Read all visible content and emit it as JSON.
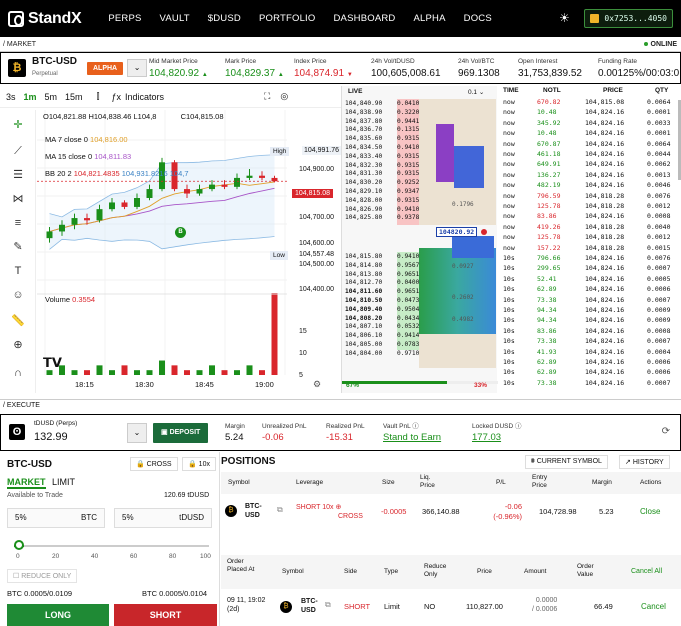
{
  "nav": {
    "brand": "StandX",
    "menu": [
      "PERPS",
      "VAULT",
      "$DUSD",
      "PORTFOLIO",
      "DASHBOARD",
      "ALPHA",
      "DOCS"
    ],
    "wallet": "0x7253...4050"
  },
  "section_market": "/ MARKET",
  "status_online": "ONLINE",
  "ticker": {
    "symbol": "BTC-USD",
    "type": "Perpetual",
    "badge": "ALPHA",
    "mid_label": "Mid Market Price",
    "mid_value": "104,820.92",
    "mark_label": "Mark Price",
    "mark_value": "104,829.37",
    "index_label": "Index Price",
    "index_value": "104,874.91",
    "vol24_label": "24h Vol/tDUSD",
    "vol24_value": "100,605,008.61",
    "volbtc_label": "24h Vol/BTC",
    "volbtc_value": "969.1308",
    "oi_label": "Open Interest",
    "oi_value": "31,753,839.52",
    "fr_label": "Funding Rate",
    "fr_value": "0.00125%/00:03:0"
  },
  "chart_toolbar": {
    "intervals": [
      "3s",
      "1m",
      "5m",
      "15m"
    ],
    "active_interval": "1m",
    "indicators_label": "Indicators"
  },
  "chart": {
    "ohlc_o": "O104,821.88",
    "ohlc_h": "H104,838.46",
    "ohlc_l": "L104,8",
    "ohlc_c": "C104,815.08",
    "ma7_label": "MA 7 close 0",
    "ma7_value": "104,816.00",
    "ma15_label": "MA 15 close 0",
    "ma15_value": "104,811.83",
    "bb_label": "BB 20 2",
    "bb_v1": "104,821.4835",
    "bb_v2": "104,931.8216",
    "bb_v3": "104,7",
    "volume_label": "Volume",
    "volume_value": "0.3554",
    "price_ticks": [
      "104,900.00",
      "104,800.00",
      "104,700.00",
      "104,600.00",
      "104,500.00",
      "104,400.00"
    ],
    "high_label": "High",
    "high_value": "104,991.76",
    "low_label": "Low",
    "low_value": "104,557.48",
    "last_price": "104,815.08",
    "vol_ticks": [
      "15",
      "10",
      "5"
    ],
    "time_ticks": [
      "18:15",
      "18:30",
      "18:45",
      "19:00"
    ],
    "marker": "B"
  },
  "chart_data": {
    "type": "candlestick",
    "x": [
      "18:03",
      "18:06",
      "18:09",
      "18:12",
      "18:15",
      "18:18",
      "18:21",
      "18:24",
      "18:27",
      "18:30",
      "18:33",
      "18:36",
      "18:39",
      "18:42",
      "18:45",
      "18:48",
      "18:51",
      "18:54",
      "18:57"
    ],
    "open": [
      104560,
      104590,
      104620,
      104650,
      104640,
      104690,
      104720,
      104700,
      104740,
      104780,
      104900,
      104780,
      104760,
      104780,
      104800,
      104790,
      104830,
      104840,
      104830
    ],
    "close": [
      104590,
      104620,
      104650,
      104640,
      104690,
      104720,
      104700,
      104740,
      104780,
      104900,
      104780,
      104760,
      104780,
      104800,
      104790,
      104830,
      104840,
      104830,
      104815
    ],
    "high": [
      104610,
      104640,
      104670,
      104670,
      104710,
      104740,
      104730,
      104760,
      104800,
      104920,
      104910,
      104800,
      104800,
      104820,
      104820,
      104850,
      104870,
      104860,
      104840
    ],
    "low": [
      104540,
      104570,
      104600,
      104620,
      104630,
      104680,
      104690,
      104690,
      104730,
      104770,
      104770,
      104740,
      104750,
      104770,
      104780,
      104780,
      104820,
      104820,
      104810
    ],
    "volume": [
      1,
      2,
      1,
      1,
      2,
      1,
      2,
      1,
      1,
      3,
      2,
      1,
      1,
      2,
      1,
      1,
      2,
      1,
      17
    ],
    "ylim": [
      104350,
      105000
    ],
    "legend": [
      "MA 7 close 0",
      "MA 15 close 0",
      "BB 20 2",
      "Volume"
    ]
  },
  "orderbook": {
    "live_label": "LIVE",
    "step": "0.1",
    "asks": [
      [
        "104,840.90",
        "0.0410"
      ],
      [
        "104,838.90",
        "0.3220"
      ],
      [
        "104,837.80",
        "0.9441"
      ],
      [
        "104,836.70",
        "0.1315"
      ],
      [
        "104,835.60",
        "0.9315"
      ],
      [
        "104,834.50",
        "0.9410"
      ],
      [
        "104,833.40",
        "0.9315"
      ],
      [
        "104,832.30",
        "0.9315"
      ],
      [
        "104,831.30",
        "0.9315"
      ],
      [
        "104,830.20",
        "0.9252"
      ],
      [
        "104,829.10",
        "0.9347"
      ],
      [
        "104,828.00",
        "0.9315"
      ],
      [
        "104,826.90",
        "0.9410"
      ],
      [
        "104,825.80",
        "0.9378"
      ]
    ],
    "bids": [
      [
        "104,815.80",
        "0.9410"
      ],
      [
        "104,814.80",
        "0.9567"
      ],
      [
        "104,813.80",
        "0.9651"
      ],
      [
        "104,812.70",
        "0.0400"
      ],
      [
        "104,811.60",
        "0.9651"
      ],
      [
        "104,810.50",
        "0.0473"
      ],
      [
        "104,809.40",
        "0.9504"
      ],
      [
        "104,808.20",
        "0.0434"
      ],
      [
        "104,807.10",
        "0.0532"
      ],
      [
        "104,806.10",
        "0.9414"
      ],
      [
        "104,805.00",
        "0.0783"
      ],
      [
        "104,804.00",
        "0.9710"
      ]
    ],
    "mid_price": "104820.92",
    "annotations": [
      "0.1796",
      "0.0927",
      "0.2602",
      "0.4982"
    ],
    "bid_pct": "67%",
    "ask_pct": "33%"
  },
  "trades": {
    "headers": [
      "TIME",
      "NOTL",
      "PRICE",
      "QTY"
    ],
    "rows": [
      [
        "now",
        "670.82",
        "104,815.08",
        "0.0064"
      ],
      [
        "now",
        "10.48",
        "104,824.16",
        "0.0001"
      ],
      [
        "now",
        "345.92",
        "104,824.16",
        "0.0033"
      ],
      [
        "now",
        "10.48",
        "104,824.16",
        "0.0001"
      ],
      [
        "now",
        "670.87",
        "104,824.16",
        "0.0064"
      ],
      [
        "now",
        "461.18",
        "104,824.16",
        "0.0044"
      ],
      [
        "now",
        "649.91",
        "104,824.16",
        "0.0062"
      ],
      [
        "now",
        "136.27",
        "104,824.16",
        "0.0013"
      ],
      [
        "now",
        "482.19",
        "104,824.16",
        "0.0046"
      ],
      [
        "now",
        "796.59",
        "104,818.28",
        "0.0076"
      ],
      [
        "now",
        "125.78",
        "104,818.28",
        "0.0012"
      ],
      [
        "now",
        "83.86",
        "104,824.16",
        "0.0008"
      ],
      [
        "now",
        "419.26",
        "104,818.28",
        "0.0040"
      ],
      [
        "now",
        "125.78",
        "104,818.28",
        "0.0012"
      ],
      [
        "now",
        "157.22",
        "104,818.28",
        "0.0015"
      ],
      [
        "10s",
        "796.66",
        "104,824.16",
        "0.0076"
      ],
      [
        "10s",
        "299.65",
        "104,824.16",
        "0.0007"
      ],
      [
        "10s",
        "52.41",
        "104,824.16",
        "0.0005"
      ],
      [
        "10s",
        "62.89",
        "104,824.16",
        "0.0006"
      ],
      [
        "10s",
        "73.38",
        "104,824.16",
        "0.0007"
      ],
      [
        "10s",
        "94.34",
        "104,824.16",
        "0.0009"
      ],
      [
        "10s",
        "94.34",
        "104,824.16",
        "0.0009"
      ],
      [
        "10s",
        "83.86",
        "104,824.16",
        "0.0008"
      ],
      [
        "10s",
        "73.38",
        "104,824.16",
        "0.0007"
      ],
      [
        "10s",
        "41.93",
        "104,824.16",
        "0.0004"
      ],
      [
        "10s",
        "62.89",
        "104,824.16",
        "0.0006"
      ],
      [
        "10s",
        "62.89",
        "104,824.16",
        "0.0006"
      ],
      [
        "10s",
        "73.38",
        "104,824.16",
        "0.0007"
      ]
    ]
  },
  "section_execute": "/ EXECUTE",
  "account": {
    "asset_label": "tDUSD (Perps)",
    "asset_value": "132.99",
    "deposit": "DEPOSIT",
    "margin_label": "Margin",
    "margin_value": "5.24",
    "upnl_label": "Unrealized PnL",
    "upnl_value": "-0.06",
    "rpnl_label": "Realized PnL",
    "rpnl_value": "-15.31",
    "vault_label": "Vault PnL",
    "vault_value": "Stand to Earn",
    "locked_label": "Locked DUSD",
    "locked_value": "177.03"
  },
  "order_form": {
    "symbol": "BTC-USD",
    "margin_mode": "CROSS",
    "leverage": "10x",
    "tab_market": "MARKET",
    "tab_limit": "LIMIT",
    "available_label": "Available to Trade",
    "available_value": "120.69 tDUSD",
    "pct_left": "5%",
    "unit_left": "BTC",
    "pct_right": "5%",
    "unit_right": "tDUSD",
    "slider_ticks": [
      "0",
      "20",
      "40",
      "60",
      "80",
      "100"
    ],
    "reduce_only": "REDUCE ONLY",
    "long_info": "BTC 0.0005/0.0109",
    "short_info": "BTC 0.0005/0.0104",
    "long_btn": "LONG",
    "short_btn": "SHORT"
  },
  "positions": {
    "title": "POSITIONS",
    "current_symbol": "CURRENT SYMBOL",
    "history": "HISTORY",
    "headers": [
      "Symbol",
      "Leverage",
      "Size",
      "Liq. Price",
      "P/L",
      "Entry Price",
      "Margin",
      "Actions"
    ],
    "row": {
      "symbol": "BTC-USD",
      "leverage": "SHORT 10x",
      "mode": "CROSS",
      "size": "-0.0005",
      "liq": "366,140.88",
      "pl": "-0.06",
      "pl_pct": "(-0.96%)",
      "entry": "104,728.98",
      "margin": "5.23",
      "action": "Close"
    },
    "order_headers": [
      "Order Placed At",
      "Symbol",
      "Side",
      "Type",
      "Reduce Only",
      "Price",
      "Amount",
      "Order Value",
      "Cancel All"
    ],
    "order_row": {
      "time": "09 11, 19:02",
      "time2": "(2d)",
      "symbol": "BTC-USD",
      "side": "SHORT",
      "type": "Limit",
      "reduce": "NO",
      "price": "110,827.00",
      "amount_a": "0.0000",
      "amount_b": "/ 0.0006",
      "value": "66.49",
      "action": "Cancel"
    }
  },
  "colors": {
    "green": "#1a8f1a",
    "red": "#d9262c",
    "accent": "#e8601c"
  }
}
